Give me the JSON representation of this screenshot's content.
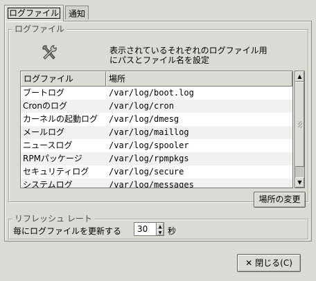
{
  "tabs": [
    {
      "label": "ログファイル",
      "active": true
    },
    {
      "label": "通知",
      "active": false
    }
  ],
  "logfiles_frame": {
    "title": "ログファイル",
    "description": "表示されているそれぞれのログファイル用\nにパスとファイル名を設定",
    "icon": "tools-icon"
  },
  "table": {
    "columns": [
      "ログファイル",
      "場所"
    ],
    "rows": [
      {
        "name": "ブートログ",
        "path": "/var/log/boot.log"
      },
      {
        "name": "Cronのログ",
        "path": "/var/log/cron"
      },
      {
        "name": "カーネルの起動ログ",
        "path": "/var/log/dmesg"
      },
      {
        "name": "メールログ",
        "path": "/var/log/maillog"
      },
      {
        "name": "ニュースログ",
        "path": "/var/log/spooler"
      },
      {
        "name": "RPMパッケージ",
        "path": "/var/log/rpmpkgs"
      },
      {
        "name": "セキュリティログ",
        "path": "/var/log/secure"
      },
      {
        "name": "システムログ",
        "path": "/var/log/messages"
      }
    ]
  },
  "change_location_button": "場所の変更",
  "refresh_frame": {
    "title": "リフレッシュ レート",
    "label": "毎にログファイルを更新する",
    "value": "30",
    "unit": "秒"
  },
  "close_button": {
    "label": "閉じる(C)",
    "icon": "close-icon"
  }
}
